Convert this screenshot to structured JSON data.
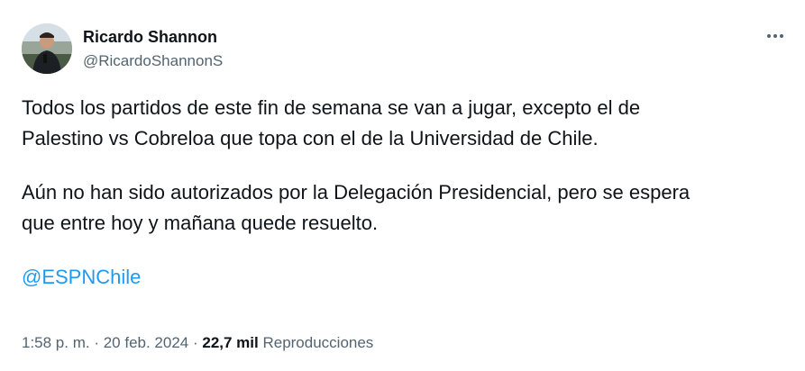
{
  "author": {
    "display_name": "Ricardo Shannon",
    "handle": "@RicardoShannonS"
  },
  "icons": {
    "more": "more-horizontal-icon"
  },
  "tweet": {
    "paragraph_1_line_1": "Todos los partidos de este fin de semana se van a jugar, excepto el de",
    "paragraph_1_line_2": "Palestino vs Cobreloa que topa con el de la Universidad de Chile.",
    "paragraph_2_line_1": "Aún no han sido autorizados por la Delegación Presidencial, pero se espera",
    "paragraph_2_line_2": "que entre hoy y mañana quede resuelto.",
    "mention": "@ESPNChile"
  },
  "meta": {
    "time": "1:58 p. m.",
    "sep1": " · ",
    "date": "20 feb. 2024",
    "sep2": " · ",
    "views_count": "22,7 mil",
    "views_label": " Reproducciones"
  },
  "colors": {
    "text": "#0f1419",
    "secondary": "#536471",
    "link": "#1d9bf0"
  }
}
